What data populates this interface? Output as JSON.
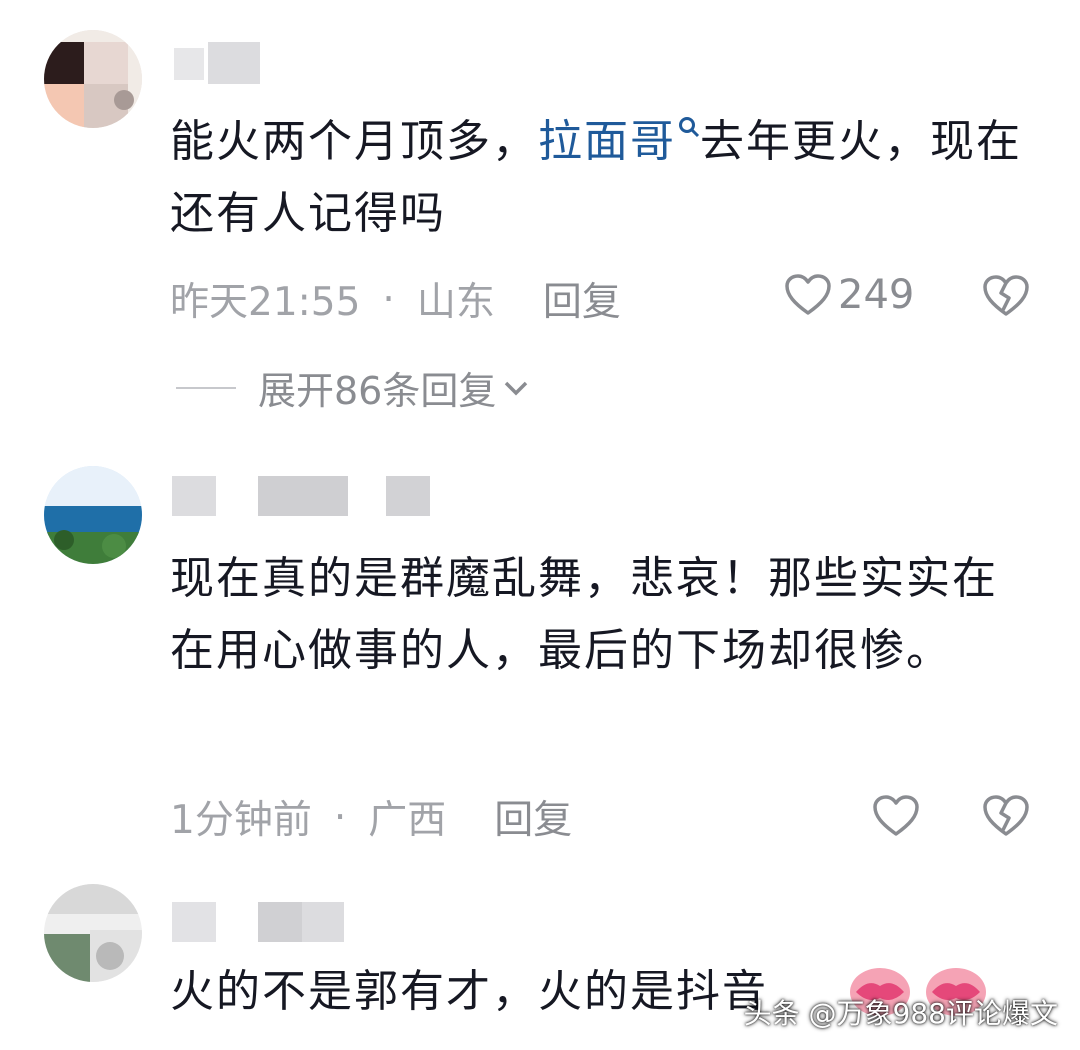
{
  "comments": [
    {
      "text_before": "能火两个月顶多，",
      "link": "拉面哥",
      "text_after": "去年更火，现在还有人记得吗",
      "time": "昨天21:55",
      "separator": "·",
      "location": "山东",
      "reply_label": "回复",
      "likes": "249",
      "expand_label": "展开86条回复"
    },
    {
      "text": "现在真的是群魔乱舞，悲哀！那些实实在在用心做事的人，最后的下场却很惨。",
      "time": "1分钟前",
      "separator": "·",
      "location": "广西",
      "reply_label": "回复"
    },
    {
      "text": "火的不是郭有才，火的是抖音"
    }
  ],
  "watermark": "头条 @万象988评论爆文",
  "icons": {
    "like": "heart-outline-icon",
    "dislike": "broken-heart-icon",
    "search": "search-icon",
    "chevron": "chevron-down-icon",
    "emoji": "kiss-lips-emoji"
  },
  "colors": {
    "text": "#161823",
    "meta": "#a1a3a8",
    "link": "#1f5a9a"
  }
}
